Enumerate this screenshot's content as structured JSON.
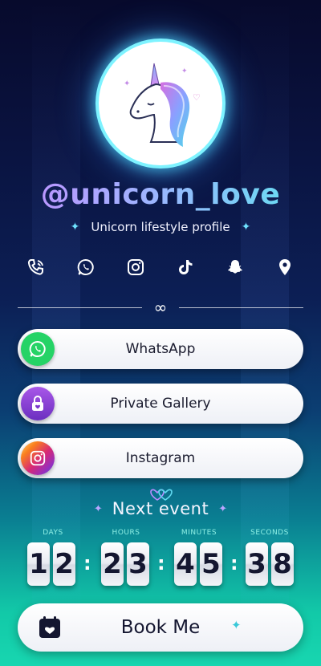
{
  "profile": {
    "username": "@unicorn_love",
    "tagline": "Unicorn lifestyle profile"
  },
  "social": [
    {
      "icon": "phone-icon"
    },
    {
      "icon": "whatsapp-icon"
    },
    {
      "icon": "instagram-icon"
    },
    {
      "icon": "tiktok-icon"
    },
    {
      "icon": "snapchat-icon"
    },
    {
      "icon": "location-pin-icon"
    }
  ],
  "links": [
    {
      "label": "WhatsApp",
      "icon": "whatsapp-icon",
      "color": "#25d366"
    },
    {
      "label": "Private Gallery",
      "icon": "lock-heart-icon",
      "color": "#8a3fd6"
    },
    {
      "label": "Instagram",
      "icon": "instagram-icon",
      "color": "#e1306c"
    }
  ],
  "event": {
    "title": "Next event",
    "labels": {
      "days": "DAYS",
      "hours": "HOURS",
      "minutes": "MINUTES",
      "seconds": "SECONDS"
    },
    "days": [
      "1",
      "2"
    ],
    "hours": [
      "2",
      "3"
    ],
    "minutes": [
      "4",
      "5"
    ],
    "seconds": [
      "3",
      "8"
    ]
  },
  "book": {
    "label": "Book Me"
  },
  "colors": {
    "accent_cyan": "#6fe2ff",
    "accent_purple": "#b9a6ff",
    "whatsapp": "#25d366"
  }
}
